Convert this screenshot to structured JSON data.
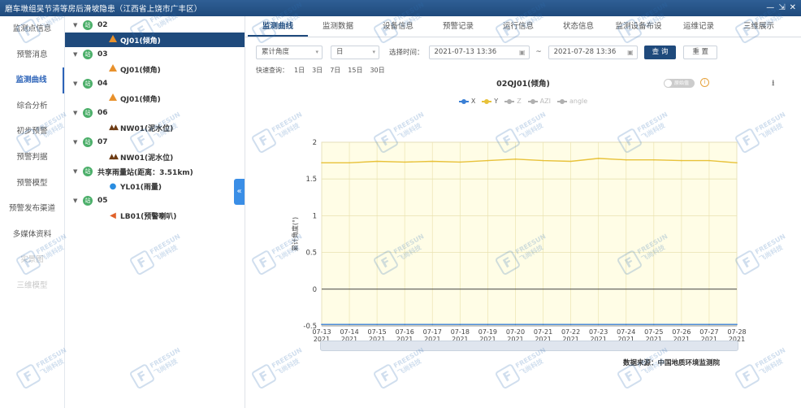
{
  "window": {
    "title": "磨车墩组吴节清等房后滑坡隐患（江西省上饶市广丰区）",
    "controls": [
      "—",
      "⇲",
      "✕"
    ]
  },
  "nav": {
    "items": [
      {
        "label": "监测点信息",
        "state": "normal"
      },
      {
        "label": "预警消息",
        "state": "normal"
      },
      {
        "label": "监测曲线",
        "state": "active"
      },
      {
        "label": "综合分析",
        "state": "normal"
      },
      {
        "label": "初步预警",
        "state": "normal"
      },
      {
        "label": "预警判据",
        "state": "normal"
      },
      {
        "label": "预警模型",
        "state": "normal"
      },
      {
        "label": "预警发布渠道",
        "state": "normal"
      },
      {
        "label": "多媒体资料",
        "state": "normal"
      },
      {
        "label": "实景图",
        "state": "dim"
      },
      {
        "label": "三维模型",
        "state": "dim"
      }
    ]
  },
  "tree": {
    "stations": [
      {
        "code": "02",
        "badge": "站",
        "devices": [
          {
            "name": "QJ01(倾角)",
            "icon": "triangle-icon",
            "selected": true
          }
        ]
      },
      {
        "code": "03",
        "badge": "站",
        "devices": [
          {
            "name": "QJ01(倾角)",
            "icon": "triangle-icon",
            "selected": false
          }
        ]
      },
      {
        "code": "04",
        "badge": "站",
        "devices": [
          {
            "name": "QJ01(倾角)",
            "icon": "triangle-icon",
            "selected": false
          }
        ]
      },
      {
        "code": "06",
        "badge": "站",
        "devices": [
          {
            "name": "NW01(泥水位)",
            "icon": "mountain-icon",
            "selected": false
          }
        ]
      },
      {
        "code": "07",
        "badge": "站",
        "devices": [
          {
            "name": "NW01(泥水位)",
            "icon": "mountain-icon",
            "selected": false
          }
        ]
      },
      {
        "code": "共享雨量站(距离：3.51km)",
        "badge": "站",
        "devices": [
          {
            "name": "YL01(雨量)",
            "icon": "raindrop-icon",
            "selected": false
          }
        ]
      },
      {
        "code": "05",
        "badge": "站",
        "devices": [
          {
            "name": "LB01(预警喇叭)",
            "icon": "horn-icon",
            "selected": false
          }
        ]
      }
    ],
    "collapse_glyph": "«"
  },
  "tabs": [
    {
      "label": "监测曲线",
      "active": true
    },
    {
      "label": "监测数据",
      "active": false
    },
    {
      "label": "设备信息",
      "active": false
    },
    {
      "label": "预警记录",
      "active": false
    },
    {
      "label": "运行信息",
      "active": false
    },
    {
      "label": "状态信息",
      "active": false
    },
    {
      "label": "监测设备布设",
      "active": false
    },
    {
      "label": "运维记录",
      "active": false
    },
    {
      "label": "三维展示",
      "active": false
    }
  ],
  "filters": {
    "metric": "累计角度",
    "interval": "日",
    "time_label": "选择时间：",
    "start": "2021-07-13 13:36",
    "separator": "~",
    "end": "2021-07-28 13:36",
    "query_button": "查 询",
    "reset_button": "重 置"
  },
  "quick": {
    "label": "快速查询：",
    "options": [
      "1日",
      "3日",
      "7日",
      "15日",
      "30日"
    ]
  },
  "chart_header": {
    "title": "02QJ01(倾角)",
    "toggle_text": "原始值",
    "info_glyph": "i",
    "download_glyph": "⭳"
  },
  "colors": {
    "X": "#3a7fd5",
    "Y": "#e8c23a",
    "Z": "#b0b0b0",
    "AZI": "#b0b0b0",
    "angle": "#b0b0b0",
    "plot_bg": "#fffde6",
    "primary": "#1f4a7c"
  },
  "chart_data": {
    "type": "line",
    "title": "02QJ01(倾角)",
    "ylabel": "累计角度(°)",
    "xlabel": "",
    "ylim": [
      -0.5,
      2
    ],
    "yticks": [
      -0.5,
      0,
      0.5,
      1,
      1.5,
      2
    ],
    "grid": true,
    "legend_position": "top-center",
    "categories": [
      "07-13\n2021",
      "07-14\n2021",
      "07-15\n2021",
      "07-16\n2021",
      "07-17\n2021",
      "07-18\n2021",
      "07-19\n2021",
      "07-20\n2021",
      "07-21\n2021",
      "07-22\n2021",
      "07-23\n2021",
      "07-24\n2021",
      "07-25\n2021",
      "07-26\n2021",
      "07-27\n2021",
      "07-28\n2021"
    ],
    "series": [
      {
        "name": "X",
        "enabled": true,
        "values": [
          -0.48,
          -0.48,
          -0.48,
          -0.48,
          -0.48,
          -0.48,
          -0.48,
          -0.48,
          -0.48,
          -0.48,
          -0.48,
          -0.48,
          -0.48,
          -0.48,
          -0.48,
          -0.48
        ]
      },
      {
        "name": "Y",
        "enabled": true,
        "values": [
          1.72,
          1.72,
          1.74,
          1.73,
          1.74,
          1.73,
          1.75,
          1.77,
          1.75,
          1.74,
          1.78,
          1.76,
          1.76,
          1.75,
          1.75,
          1.72
        ]
      },
      {
        "name": "Z",
        "enabled": false,
        "values": []
      },
      {
        "name": "AZI",
        "enabled": false,
        "values": []
      },
      {
        "name": "angle",
        "enabled": false,
        "values": []
      }
    ]
  },
  "footer": {
    "source": "数据来源：中国地质环境监测院"
  },
  "watermark": {
    "glyph": "F",
    "line1": "FREESUN",
    "line2": "飞尚科技"
  }
}
